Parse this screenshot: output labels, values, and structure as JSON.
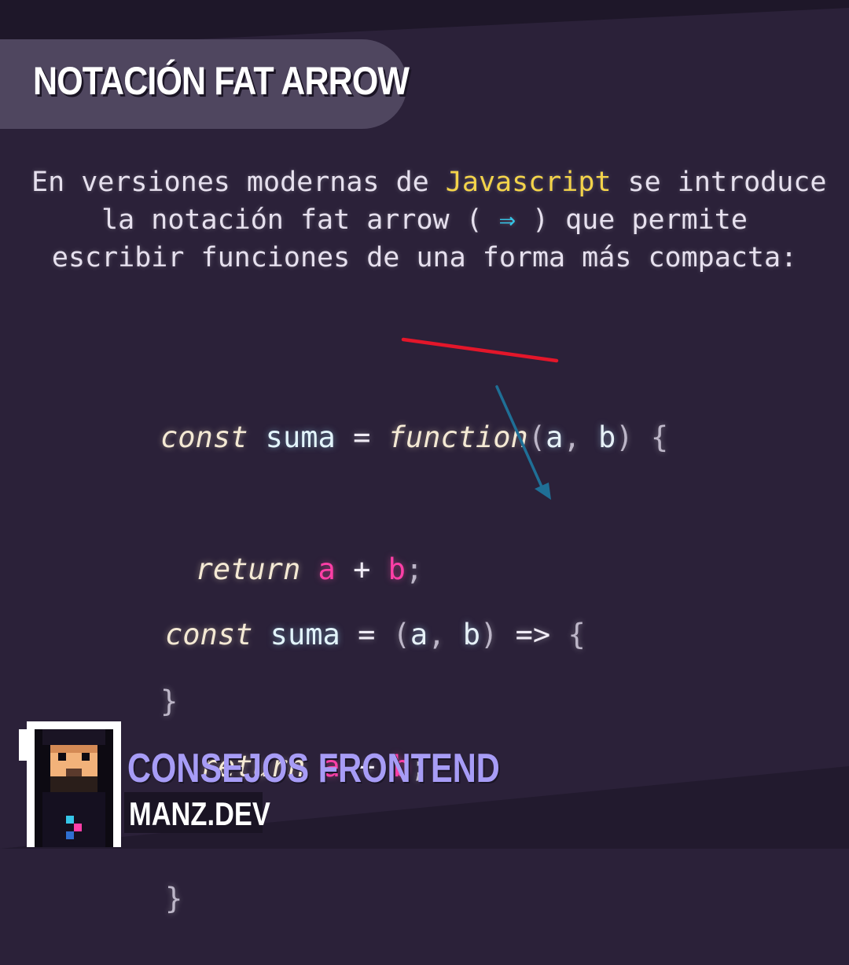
{
  "title": "NOTACIÓN FAT ARROW",
  "intro": {
    "line1_pre": "En versiones modernas de ",
    "line1_highlight": "Javascript",
    "line1_post": " se introduce",
    "line2_pre": "la notación fat arrow ( ",
    "line2_arrow": "⇒",
    "line2_post": " ) que permite",
    "line3": "escribir funciones de una forma más compacta:"
  },
  "code_before": {
    "kw_const": "const",
    "name": "suma",
    "eq": "=",
    "struck_keyword": "function",
    "param_a": "a",
    "param_b": "b",
    "return_kw": "return",
    "var_a": "a",
    "plus": "+",
    "var_b": "b",
    "semi": ";",
    "open_brace": "{",
    "close_brace": "}"
  },
  "code_after": {
    "kw_const": "const",
    "name": "suma",
    "eq": "=",
    "param_a": "a",
    "param_b": "b",
    "arrow": "=>",
    "return_kw": "return",
    "var_a": "a",
    "plus": "+",
    "var_b": "b",
    "semi": ";",
    "open_brace": "{",
    "close_brace": "}"
  },
  "footer": {
    "brand": "CONSEJOS FRONTEND",
    "site": "MANZ.DEV"
  },
  "colors": {
    "background": "#2b2139",
    "highlight_js": "#f3d34a",
    "highlight_arrow": "#35c6e8",
    "strike": "#e3162a",
    "pointer_arrow": "#1f6f96",
    "variable_pink": "#ff3fa7",
    "brand_purple": "#a79cf6"
  }
}
